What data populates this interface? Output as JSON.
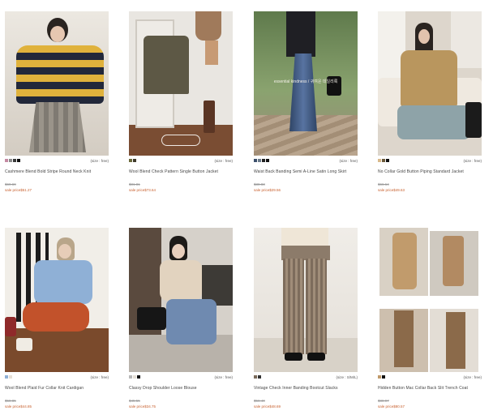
{
  "products": [
    {
      "name": "Cashmere Blend Bold Stripe Round Neck Knit",
      "original_price": "$69.69",
      "sale_price": "sale price$51.27",
      "size": "(size : free)",
      "swatches": [
        "#c48aa2",
        "#8a8a8a",
        "#3a3a3a",
        "#111111"
      ],
      "photo_bg": "#dcd6cc"
    },
    {
      "name": "Wool Blend Check Pattern Single Button Jacket",
      "original_price": "$81.81",
      "sale_price": "sale price$73.64",
      "size": "(size : free)",
      "swatches": [
        "#6b6a3b",
        "#3f3a2b"
      ],
      "photo_bg": "#8a6a52"
    },
    {
      "name": "Waist Back Banding Semi A-Line Satin Long Skirt",
      "original_price": "$38.83",
      "sale_price": "sale price$29.56",
      "size": "(size : free)",
      "swatches": [
        "#3b4f6b",
        "#6a7a8a",
        "#222222",
        "#111111"
      ],
      "photo_bg": "#6f8a5b"
    },
    {
      "name": "No Collar Gold Button Piping Standard Jacket",
      "original_price": "$66.64",
      "sale_price": "sale price$49.63",
      "size": "(size : free)",
      "swatches": [
        "#d9b98a",
        "#6b5a3b",
        "#111111"
      ],
      "photo_bg": "#d8cfc2"
    },
    {
      "name": "Wool Blend Plaid Fur Collar Knit Cardigan",
      "original_price": "$58.85",
      "sale_price": "sale price$44.85",
      "size": "(size : free)",
      "swatches": [
        "#8fb0d6",
        "#e6e0d6"
      ],
      "photo_bg": "#e9e4dc"
    },
    {
      "name": "Classy Drop Shoulder Loose Blouse",
      "original_price": "$45.55",
      "sale_price": "sale price$34.75",
      "size": "(size : free)",
      "swatches": [
        "#b8b8b8",
        "#e6e0d6",
        "#111111"
      ],
      "photo_bg": "#cfcac2"
    },
    {
      "name": "Vintage Check Inner Banding Bootcut Slacks",
      "original_price": "$56.40",
      "sale_price": "sale price$48.69",
      "size": "(size : S/M/L)",
      "swatches": [
        "#7a6a5a",
        "#333333"
      ],
      "photo_bg": "#ebe7e2"
    },
    {
      "name": "Hidden Button Mac Collar Back Slit Trench Coat",
      "original_price": "$88.97",
      "sale_price": "sale price$80.57",
      "size": "(size : free)",
      "swatches": [
        "#c09a6a",
        "#111111"
      ],
      "photo_bg": "#e6e1da"
    }
  ],
  "overlays": {
    "photo2_button": "",
    "photo3_script": "essential kindness / 귀여운 데일리룩"
  }
}
